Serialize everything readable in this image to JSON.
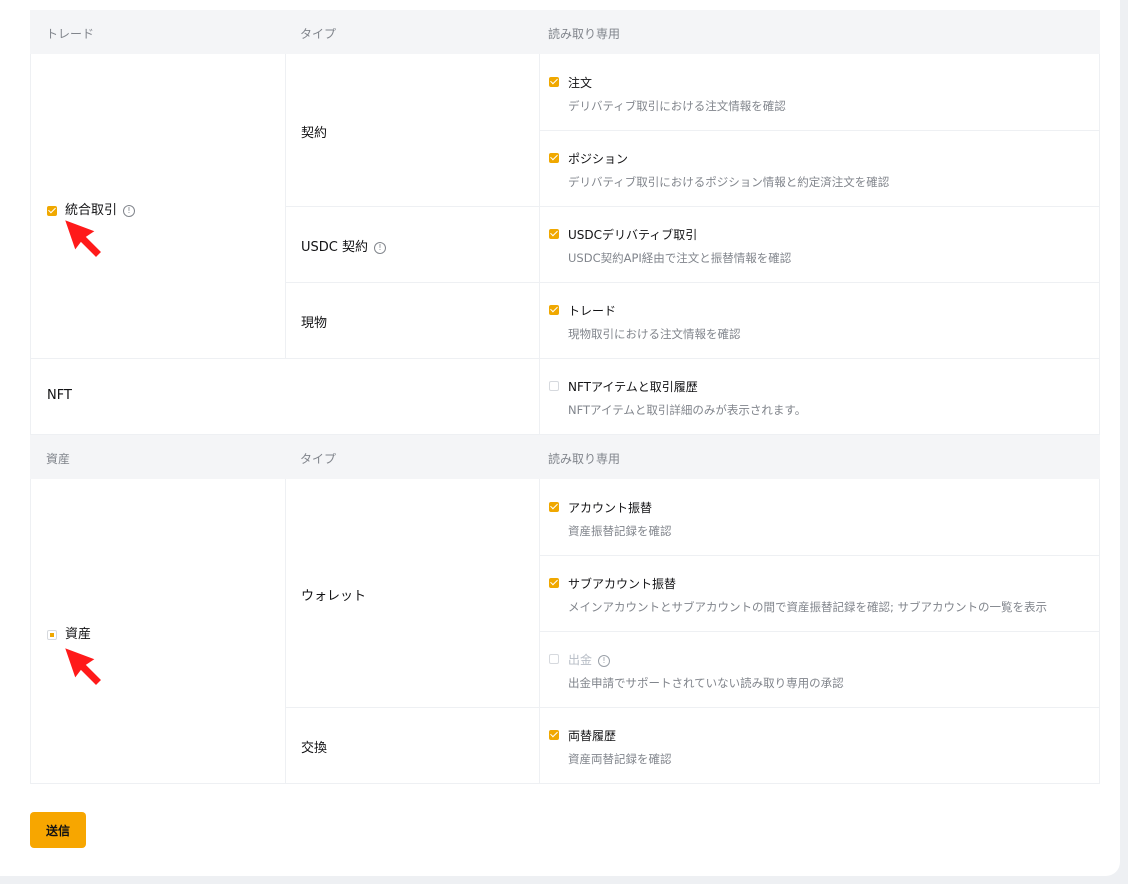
{
  "section1": {
    "headers": {
      "col1": "トレード",
      "col2": "タイプ",
      "col3": "読み取り専用"
    },
    "group": {
      "label": "統合取引",
      "checked": true
    },
    "types": [
      {
        "label": "契約"
      },
      {
        "label": "USDC 契約"
      },
      {
        "label": "現物"
      }
    ],
    "perms": [
      {
        "title": "注文",
        "desc": "デリバティブ取引における注文情報を確認",
        "checked": true
      },
      {
        "title": "ポジション",
        "desc": "デリバティブ取引におけるポジション情報と約定済注文を確認",
        "checked": true
      },
      {
        "title": "USDCデリバティブ取引",
        "desc": "USDC契約API経由で注文と振替情報を確認",
        "checked": true
      },
      {
        "title": "トレード",
        "desc": "現物取引における注文情報を確認",
        "checked": true
      }
    ],
    "nft": {
      "label": "NFT",
      "title": "NFTアイテムと取引履歴",
      "desc": "NFTアイテムと取引詳細のみが表示されます。",
      "checked": false
    }
  },
  "section2": {
    "headers": {
      "col1": "資産",
      "col2": "タイプ",
      "col3": "読み取り専用"
    },
    "group": {
      "label": "資産",
      "state": "partial"
    },
    "types": [
      {
        "label": "ウォレット"
      },
      {
        "label": "交換"
      }
    ],
    "perms": [
      {
        "title": "アカウント振替",
        "desc": "資産振替記録を確認",
        "checked": true
      },
      {
        "title": "サブアカウント振替",
        "desc": "メインアカウントとサブアカウントの間で資産振替記録を確認; サブアカウントの一覧を表示",
        "checked": true
      },
      {
        "title": "出金",
        "desc": "出金申請でサポートされていない読み取り専用の承認",
        "checked": false,
        "disabled": true
      },
      {
        "title": "両替履歴",
        "desc": "資産両替記録を確認",
        "checked": true
      }
    ]
  },
  "submit_label": "送信",
  "colors": {
    "accent": "#f7a600",
    "check": "#f0a800",
    "pointer": "#ff1a1a"
  }
}
